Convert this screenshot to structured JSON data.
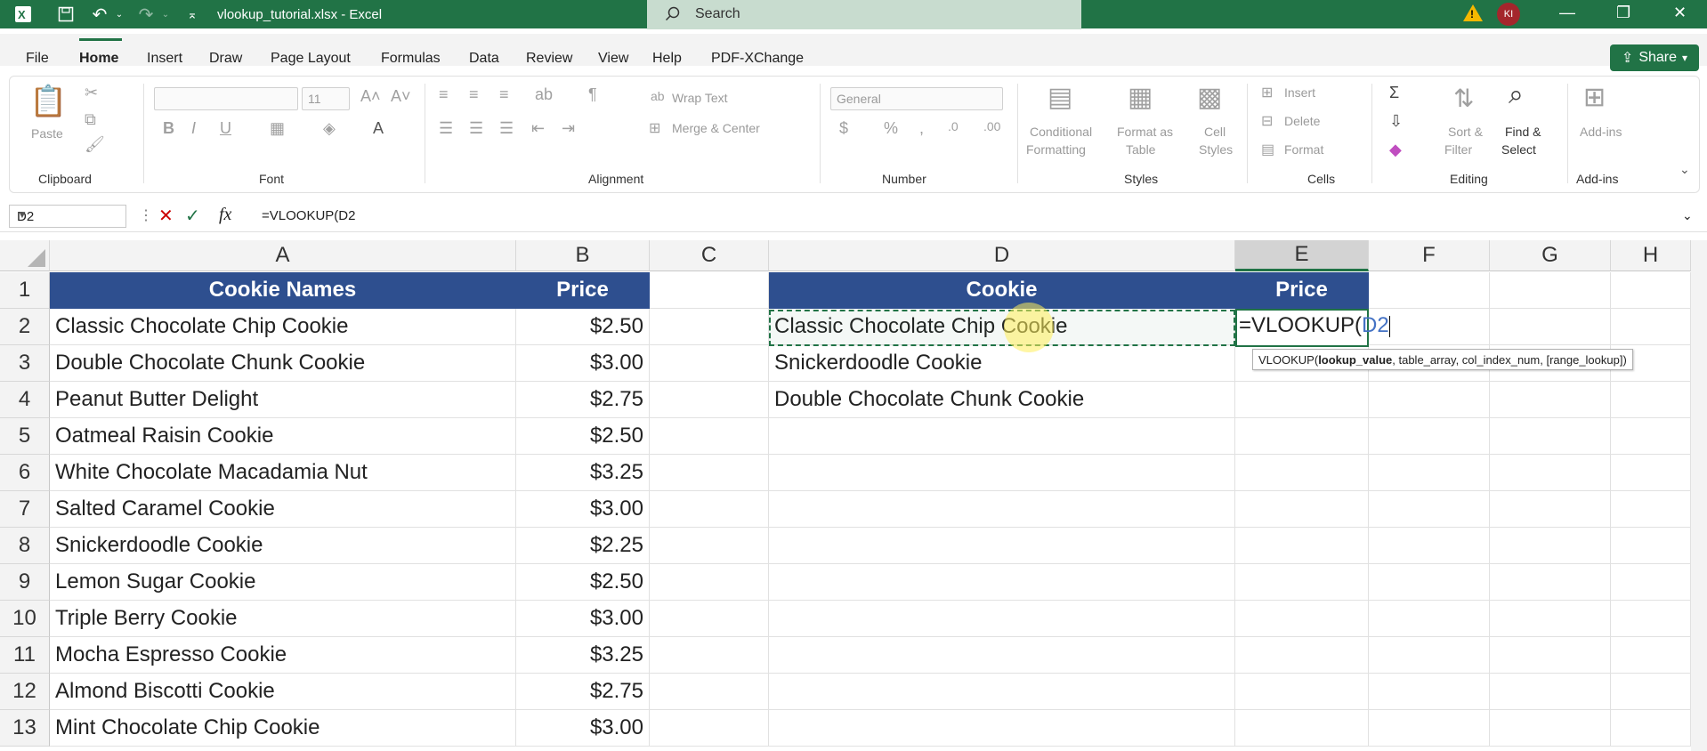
{
  "titlebar": {
    "filename": "vlookup_tutorial.xlsx  -  Excel",
    "search_placeholder": "Search",
    "user_initials": "KI"
  },
  "menu": {
    "tabs": [
      "File",
      "Home",
      "Insert",
      "Draw",
      "Page Layout",
      "Formulas",
      "Data",
      "Review",
      "View",
      "Help",
      "PDF-XChange"
    ],
    "active_tab": "Home",
    "share_label": "Share"
  },
  "ribbon": {
    "clipboard": {
      "paste": "Paste",
      "group": "Clipboard"
    },
    "font": {
      "font_size": "11",
      "group": "Font"
    },
    "alignment": {
      "wrap_text": "Wrap Text",
      "merge_center": "Merge & Center",
      "group": "Alignment"
    },
    "number": {
      "format": "General",
      "group": "Number"
    },
    "styles": {
      "conditional": "Conditional",
      "formatting": "Formatting",
      "format_as": "Format as",
      "table": "Table",
      "cell": "Cell",
      "styles_label": "Styles",
      "group": "Styles"
    },
    "cells": {
      "insert": "Insert",
      "delete": "Delete",
      "format": "Format",
      "group": "Cells"
    },
    "editing": {
      "sort": "Sort &",
      "filter": "Filter",
      "find": "Find &",
      "select": "Select",
      "group": "Editing"
    },
    "addins": {
      "label": "Add-ins",
      "group": "Add-ins"
    }
  },
  "formula_bar": {
    "name_box": "D2",
    "formula": "=VLOOKUP(D2"
  },
  "columns": [
    "A",
    "B",
    "C",
    "D",
    "E",
    "F",
    "G",
    "H"
  ],
  "rows": [
    "1",
    "2",
    "3",
    "4",
    "5",
    "6",
    "7",
    "8",
    "9",
    "10",
    "11",
    "12",
    "13"
  ],
  "table1": {
    "headers": [
      "Cookie Names",
      "Price"
    ],
    "rows": [
      [
        "Classic Chocolate Chip Cookie",
        "$2.50"
      ],
      [
        "Double Chocolate Chunk Cookie",
        "$3.00"
      ],
      [
        "Peanut Butter Delight",
        "$2.75"
      ],
      [
        "Oatmeal Raisin Cookie",
        "$2.50"
      ],
      [
        "White Chocolate Macadamia Nut",
        "$3.25"
      ],
      [
        "Salted Caramel Cookie",
        "$3.00"
      ],
      [
        "Snickerdoodle Cookie",
        "$2.25"
      ],
      [
        "Lemon Sugar Cookie",
        "$2.50"
      ],
      [
        "Triple Berry Cookie",
        "$3.00"
      ],
      [
        "Mocha Espresso Cookie",
        "$3.25"
      ],
      [
        "Almond Biscotti Cookie",
        "$2.75"
      ],
      [
        "Mint Chocolate Chip Cookie",
        "$3.00"
      ]
    ]
  },
  "table2": {
    "headers": [
      "Cookie",
      "Price"
    ],
    "rows": [
      "Classic Chocolate Chip Cookie",
      "Snickerdoodle Cookie",
      "Double Chocolate Chunk Cookie"
    ]
  },
  "editing_cell": {
    "prefix": "=VLOOKUP(",
    "ref": "D2"
  },
  "tooltip": {
    "func": "VLOOKUP(",
    "arg_bold": "lookup_value",
    "rest": ", table_array, col_index_num, [range_lookup])"
  },
  "colors": {
    "excel_green": "#217346",
    "header_blue": "#2e4f8f"
  }
}
